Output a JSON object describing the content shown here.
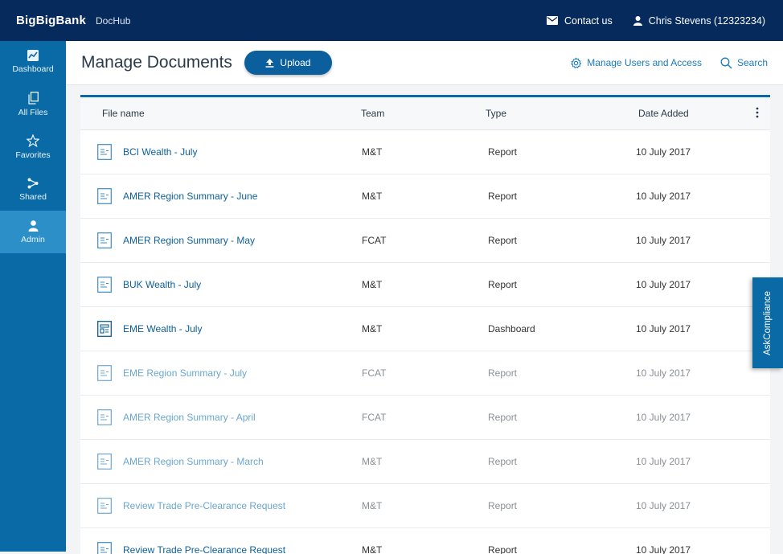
{
  "topbar": {
    "brand": "BigBigBank",
    "app_name": "DocHub",
    "contact": "Contact us",
    "user": "Chris Stevens (12323234)"
  },
  "sidebar": {
    "items": [
      {
        "label": "Dashboard",
        "icon": "chart-icon"
      },
      {
        "label": "All Files",
        "icon": "files-icon"
      },
      {
        "label": "Favorites",
        "icon": "star-icon"
      },
      {
        "label": "Shared",
        "icon": "share-icon"
      },
      {
        "label": "Admin",
        "icon": "user-icon",
        "active": true
      }
    ]
  },
  "header": {
    "title": "Manage Documents",
    "upload_label": "Upload",
    "manage_users": "Manage Users and Access",
    "search": "Search"
  },
  "table": {
    "columns": {
      "name": "File name",
      "team": "Team",
      "type": "Type",
      "date": "Date Added"
    },
    "rows": [
      {
        "name": "BCI Wealth - July",
        "team": "M&T",
        "type": "Report",
        "date": "10 July 2017"
      },
      {
        "name": "AMER Region Summary - June",
        "team": "M&T",
        "type": "Report",
        "date": "10 July 2017"
      },
      {
        "name": "AMER Region Summary - May",
        "team": "FCAT",
        "type": "Report",
        "date": "10 July 2017"
      },
      {
        "name": "BUK Wealth - July",
        "team": "M&T",
        "type": "Report",
        "date": "10 July 2017"
      },
      {
        "name": "EME Wealth - July",
        "team": "M&T",
        "type": "Dashboard",
        "date": "10 July 2017"
      },
      {
        "name": "EME Region Summary - July",
        "team": "FCAT",
        "type": "Report",
        "date": "10 July 2017"
      },
      {
        "name": "AMER Region Summary - April",
        "team": "FCAT",
        "type": "Report",
        "date": "10 July 2017"
      },
      {
        "name": "AMER Region Summary - March",
        "team": "M&T",
        "type": "Report",
        "date": "10 July 2017"
      },
      {
        "name": "Review Trade Pre-Clearance Request",
        "team": "M&T",
        "type": "Report",
        "date": "10 July 2017"
      },
      {
        "name": "Review Trade Pre-Clearance Request",
        "team": "M&T",
        "type": "Report",
        "date": "10 July 2017"
      }
    ]
  },
  "ask_tab": "AskCompliance",
  "colors": {
    "topbar": "#062a5c",
    "sidebar": "#0a6aa6",
    "sidebar_active": "#2d8fc8",
    "link": "#0b5f9a"
  }
}
